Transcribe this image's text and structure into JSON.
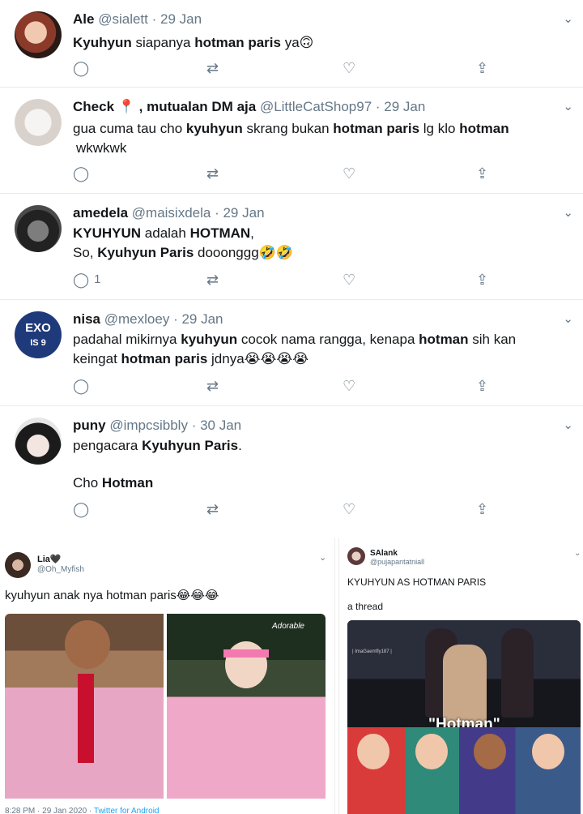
{
  "tweets": [
    {
      "name": "Ale",
      "handle": "@sialett",
      "date": "· 29 Jan",
      "body": [
        {
          "t": "Kyuhyun",
          "b": true
        },
        {
          "t": " siapanya ",
          "b": false
        },
        {
          "t": "hotman paris",
          "b": true
        },
        {
          "t": " ya",
          "b": false
        }
      ],
      "emoji": "🙃",
      "reply_count": ""
    },
    {
      "name": "Check",
      "name_suffix": ", mutualan DM aja",
      "handle": "@LittleCatShop97",
      "date": "· 29 Jan",
      "line1": [
        {
          "t": "gua cuma tau cho ",
          "b": false
        },
        {
          "t": "kyuhyun",
          "b": true
        },
        {
          "t": " skrang bukan ",
          "b": false
        },
        {
          "t": "hotman paris",
          "b": true
        },
        {
          "t": " lg klo ",
          "b": false
        },
        {
          "t": "hotman",
          "b": true
        }
      ],
      "line2": "wkwkwk",
      "reply_count": ""
    },
    {
      "name": "amedela",
      "handle": "@maisixdela",
      "date": "· 29 Jan",
      "line1": [
        {
          "t": "KYUHYUN",
          "b": true
        },
        {
          "t": " adalah ",
          "b": false
        },
        {
          "t": "HOTMAN",
          "b": true
        },
        {
          "t": ",",
          "b": false
        }
      ],
      "line2": [
        {
          "t": "So, ",
          "b": false
        },
        {
          "t": "Kyuhyun Paris",
          "b": true
        },
        {
          "t": " dooonggg",
          "b": false
        }
      ],
      "emoji": "🤣🤣",
      "reply_count": "1"
    },
    {
      "name": "nisa",
      "handle": "@mexloey",
      "date": "· 29 Jan",
      "avatar_text": "EXO",
      "avatar_sub": "IS 9",
      "line1": [
        {
          "t": "padahal mikirnya ",
          "b": false
        },
        {
          "t": "kyuhyun",
          "b": true
        },
        {
          "t": " cocok nama rangga, kenapa ",
          "b": false
        },
        {
          "t": "hotman",
          "b": true
        },
        {
          "t": " sih kan",
          "b": false
        }
      ],
      "line2": [
        {
          "t": "keingat ",
          "b": false
        },
        {
          "t": "hotman paris",
          "b": true
        },
        {
          "t": " jdnya",
          "b": false
        }
      ],
      "emoji": "😭😭😭😭",
      "reply_count": ""
    },
    {
      "name": "puny",
      "handle": "@impcsibbly",
      "date": "· 30 Jan",
      "line1": [
        {
          "t": "pengacara ",
          "b": false
        },
        {
          "t": "Kyuhyun Paris",
          "b": true
        },
        {
          "t": ".",
          "b": false
        }
      ],
      "line2": [
        {
          "t": "Cho ",
          "b": false
        },
        {
          "t": "Hotman",
          "b": true
        }
      ],
      "reply_count": ""
    }
  ],
  "icons": {
    "reply": "reply-icon",
    "retweet": "retweet-icon",
    "like": "like-icon",
    "share": "share-icon",
    "chevron": "chevron-down-icon"
  },
  "glyphs": {
    "reply": "◯",
    "retweet": "⇄",
    "like": "♡",
    "share": "⇪",
    "chevron": "⌄",
    "pin": "📍"
  },
  "bottom_left": {
    "name": "Lia",
    "name_extra": "🖤",
    "handle": "@Oh_Myfish",
    "text": "kyuhyun anak nya hotman paris",
    "emoji": "😂😂😂",
    "photo_sig": "Adorable",
    "footer_time": "8:28 PM · 29 Jan 2020 · ",
    "footer_app": "Twitter for Android"
  },
  "bottom_right": {
    "name": "SAlank",
    "handle": "@pujapantatniall",
    "text1": "KYUHYUN AS HOTMAN PARIS",
    "text2": "a thread",
    "image_label": "| ImaGaemfly187 |",
    "caption": "\"Hotman\""
  },
  "colors": {
    "text": "#14171a",
    "muted": "#657786",
    "link": "#1da1f2",
    "divider": "#e6ecf0"
  }
}
